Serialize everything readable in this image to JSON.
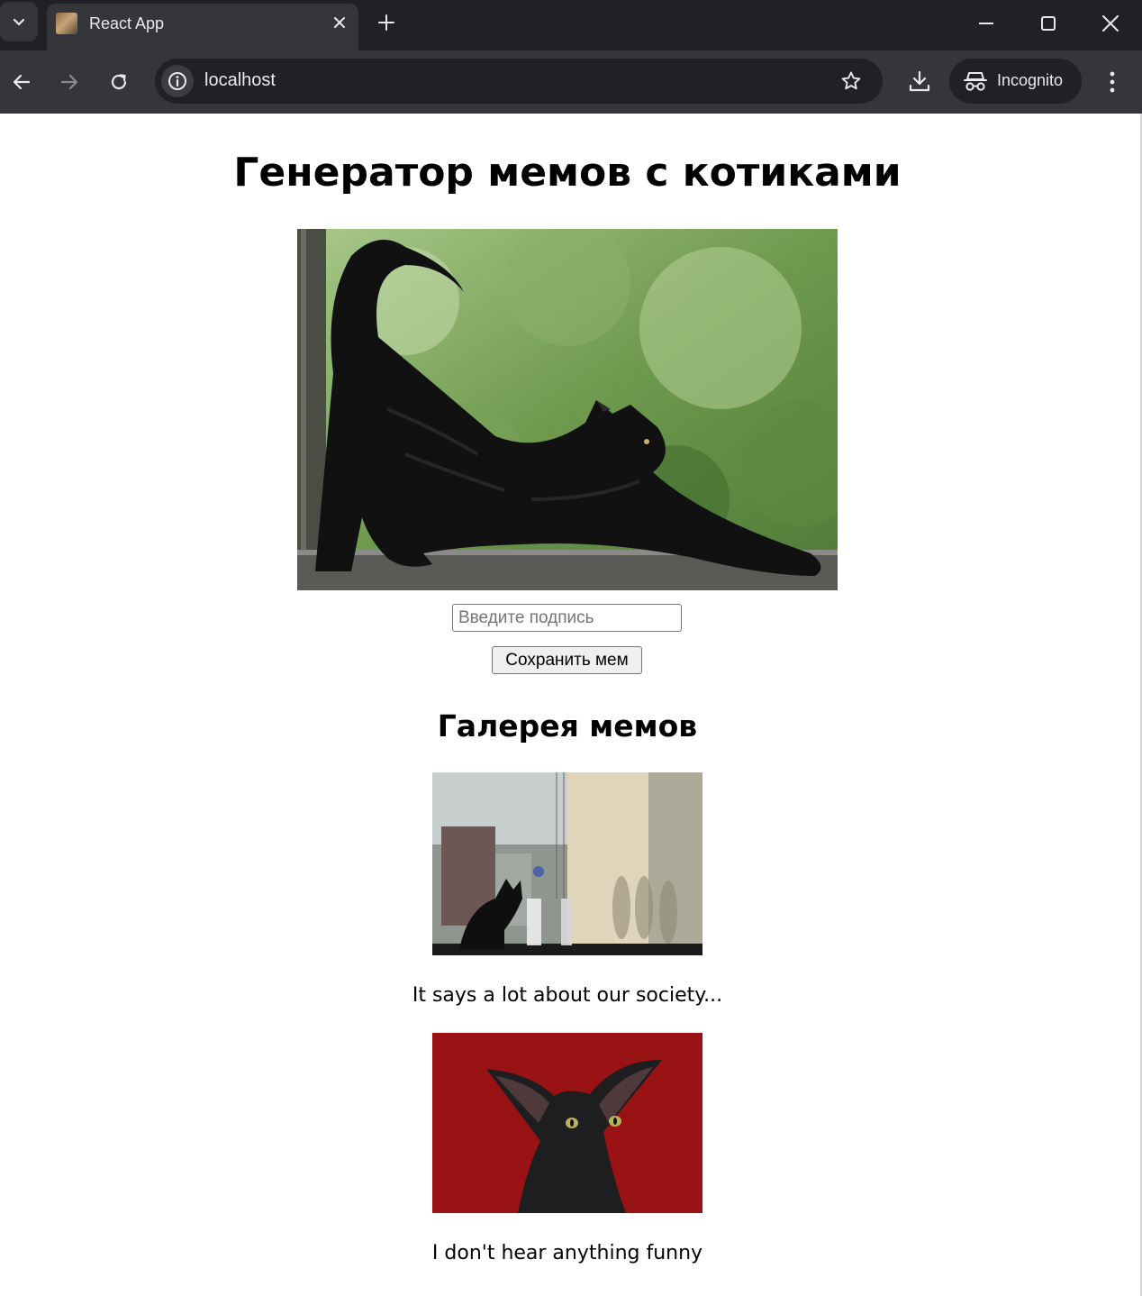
{
  "browser": {
    "tab_title": "React App",
    "url": "localhost",
    "incognito_label": "Incognito",
    "theme": {
      "frame": "#202124",
      "toolbar": "#35363a",
      "text": "#e8eaed"
    }
  },
  "page": {
    "title": "Генератор мемов с котиками",
    "caption_placeholder": "Введите подпись",
    "caption_value": "",
    "save_button": "Сохранить мем",
    "gallery_title": "Галерея мемов",
    "gallery": [
      {
        "caption": "It says a lot about our society..."
      },
      {
        "caption": "I don't hear anything funny"
      }
    ]
  },
  "icons": {
    "tab_menu": "chevron-down-icon",
    "close_tab": "close-icon",
    "new_tab": "plus-icon",
    "minimize": "minimize-icon",
    "maximize": "maximize-icon",
    "close_window": "close-icon",
    "back": "arrow-left-icon",
    "forward": "arrow-right-icon",
    "reload": "reload-icon",
    "site_info": "info-icon",
    "bookmark": "star-icon",
    "downloads": "download-icon",
    "incognito": "incognito-icon",
    "menu": "kebab-menu-icon"
  }
}
